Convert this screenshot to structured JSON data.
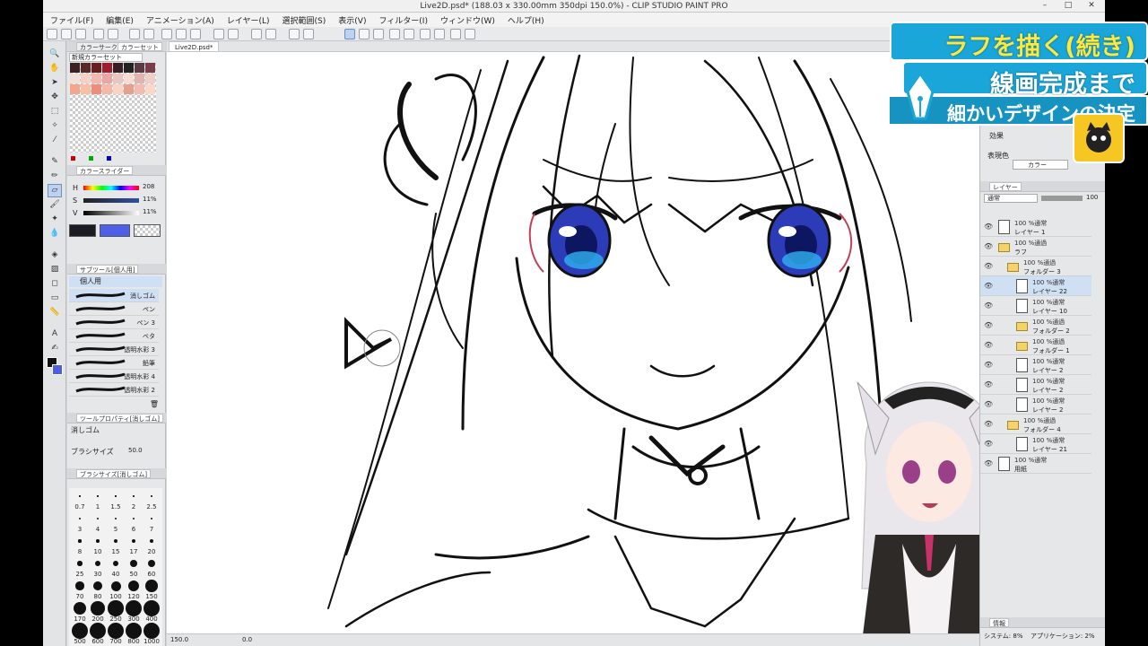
{
  "window": {
    "title": "Live2D.psd* (188.03 x 330.00mm 350dpi 150.0%) - CLIP STUDIO PAINT PRO",
    "buttons": [
      "–",
      "□",
      "✕"
    ]
  },
  "menu": [
    "ファイル(F)",
    "編集(E)",
    "アニメーション(A)",
    "レイヤー(L)",
    "選択範囲(S)",
    "表示(V)",
    "フィルター(I)",
    "ウィンドウ(W)",
    "ヘルプ(H)"
  ],
  "color_panel": {
    "tabs": [
      "カラーサークル",
      "カラーセット"
    ],
    "set_name": "新規カラーセット"
  },
  "color_slider": {
    "tabs": [
      "カラースライダー"
    ],
    "rows": [
      {
        "label": "H",
        "value": "208"
      },
      {
        "label": "S",
        "value": "11%"
      },
      {
        "label": "V",
        "value": "11%"
      }
    ]
  },
  "subtool": {
    "tab": "サブツール[個人用]",
    "group": "個人用",
    "brushes": [
      "消しゴム",
      "ペン",
      "ペン 3",
      "ベタ",
      "透明水彩 3",
      "鉛筆",
      "透明水彩 4",
      "透明水彩 2"
    ],
    "selected_index": 0
  },
  "tool_property": {
    "tab": "ツールプロパティ[消しゴム]",
    "tool_name": "消しゴム",
    "brush_size_label": "ブラシサイズ",
    "brush_size_value": "50.0"
  },
  "brush_size_panel": {
    "tab": "ブラシサイズ[消しゴム]",
    "sizes": [
      "0.7",
      "1",
      "1.5",
      "2",
      "2.5",
      "3",
      "4",
      "5",
      "6",
      "7",
      "8",
      "10",
      "15",
      "17",
      "20",
      "25",
      "30",
      "40",
      "50",
      "60",
      "70",
      "80",
      "100",
      "120",
      "150",
      "170",
      "200",
      "250",
      "300",
      "400",
      "500",
      "600",
      "700",
      "800",
      "1000"
    ]
  },
  "document": {
    "tab": "Live2D.psd*",
    "zoom": "150.0",
    "angle": "0.0"
  },
  "properties": {
    "effect_label": "効果",
    "display_color_label": "表現色",
    "display_color_value": "カラー"
  },
  "layer_panel": {
    "tab": "レイヤー",
    "blend_mode": "通常",
    "opacity": "100",
    "layers": [
      {
        "mode": "100 %通常",
        "name": "レイヤー 1",
        "type": "layer",
        "indent": 0
      },
      {
        "mode": "100 %通過",
        "name": "ラフ",
        "type": "folder",
        "indent": 0
      },
      {
        "mode": "100 %通過",
        "name": "フォルダー 3",
        "type": "folder",
        "indent": 1
      },
      {
        "mode": "100 %通常",
        "name": "レイヤー 22",
        "type": "layer",
        "indent": 2,
        "selected": true
      },
      {
        "mode": "100 %通常",
        "name": "レイヤー 10",
        "type": "layer",
        "indent": 2
      },
      {
        "mode": "100 %通過",
        "name": "フォルダー 2",
        "type": "folder",
        "indent": 2
      },
      {
        "mode": "100 %通過",
        "name": "フォルダー 1",
        "type": "folder",
        "indent": 2
      },
      {
        "mode": "100 %通常",
        "name": "レイヤー 2",
        "type": "layer",
        "indent": 2
      },
      {
        "mode": "100 %通常",
        "name": "レイヤー 2",
        "type": "layer",
        "indent": 2
      },
      {
        "mode": "100 %通常",
        "name": "レイヤー 2",
        "type": "layer",
        "indent": 2
      },
      {
        "mode": "100 %通過",
        "name": "フォルダー 4",
        "type": "folder",
        "indent": 1
      },
      {
        "mode": "100 %通常",
        "name": "レイヤー 21",
        "type": "layer",
        "indent": 2
      },
      {
        "mode": "100 %通常",
        "name": "用紙",
        "type": "paper",
        "indent": 0
      }
    ]
  },
  "info_panel": {
    "tab": "情報",
    "system": "システム: 8%",
    "application": "アプリケーション: 2%"
  },
  "overlay": {
    "line1": "ラフを描く(続き)",
    "line2": "線画完成まで",
    "line3": "細かいデザインの決定",
    "colors": {
      "banner": "#1aa6d8",
      "highlight": "#ffe83c",
      "badge": "#f6c623"
    }
  }
}
